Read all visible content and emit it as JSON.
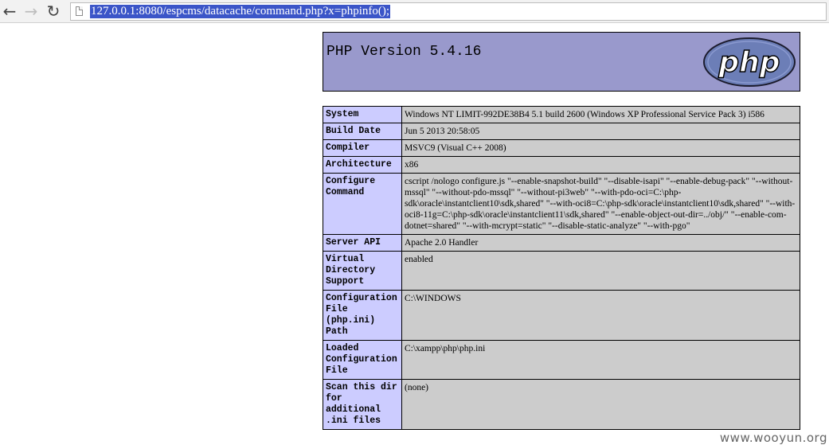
{
  "browser": {
    "url": "127.0.0.1:8080/espcms/datacache/command.php?x=phpinfo();",
    "back_icon": "arrow-left-icon",
    "forward_icon": "arrow-right-icon",
    "reload_icon": "reload-icon",
    "page_icon": "page-icon"
  },
  "phpinfo": {
    "version": "PHP Version 5.4.16",
    "logo_text": "php",
    "colors": {
      "header_bg": "#9999cc",
      "label_bg": "#ccccff",
      "value_bg": "#cccccc"
    },
    "rows": [
      {
        "label": "System",
        "value": "Windows NT LIMIT-992DE38B4 5.1 build 2600 (Windows XP Professional Service Pack 3) i586"
      },
      {
        "label": "Build Date",
        "value": "Jun 5 2013 20:58:05"
      },
      {
        "label": "Compiler",
        "value": "MSVC9 (Visual C++ 2008)"
      },
      {
        "label": "Architecture",
        "value": "x86"
      },
      {
        "label": "Configure Command",
        "value": "cscript /nologo configure.js \"--enable-snapshot-build\" \"--disable-isapi\" \"--enable-debug-pack\" \"--without-mssql\" \"--without-pdo-mssql\" \"--without-pi3web\" \"--with-pdo-oci=C:\\php-sdk\\oracle\\instantclient10\\sdk,shared\" \"--with-oci8=C:\\php-sdk\\oracle\\instantclient10\\sdk,shared\" \"--with-oci8-11g=C:\\php-sdk\\oracle\\instantclient11\\sdk,shared\" \"--enable-object-out-dir=../obj/\" \"--enable-com-dotnet=shared\" \"--with-mcrypt=static\" \"--disable-static-analyze\" \"--with-pgo\""
      },
      {
        "label": "Server API",
        "value": "Apache 2.0 Handler"
      },
      {
        "label": "Virtual Directory Support",
        "value": "enabled"
      },
      {
        "label": "Configuration File (php.ini) Path",
        "value": "C:\\WINDOWS"
      },
      {
        "label": "Loaded Configuration File",
        "value": "C:\\xampp\\php\\php.ini"
      },
      {
        "label": "Scan this dir for additional .ini files",
        "value": "(none)"
      }
    ]
  },
  "watermark": "www.wooyun.org"
}
